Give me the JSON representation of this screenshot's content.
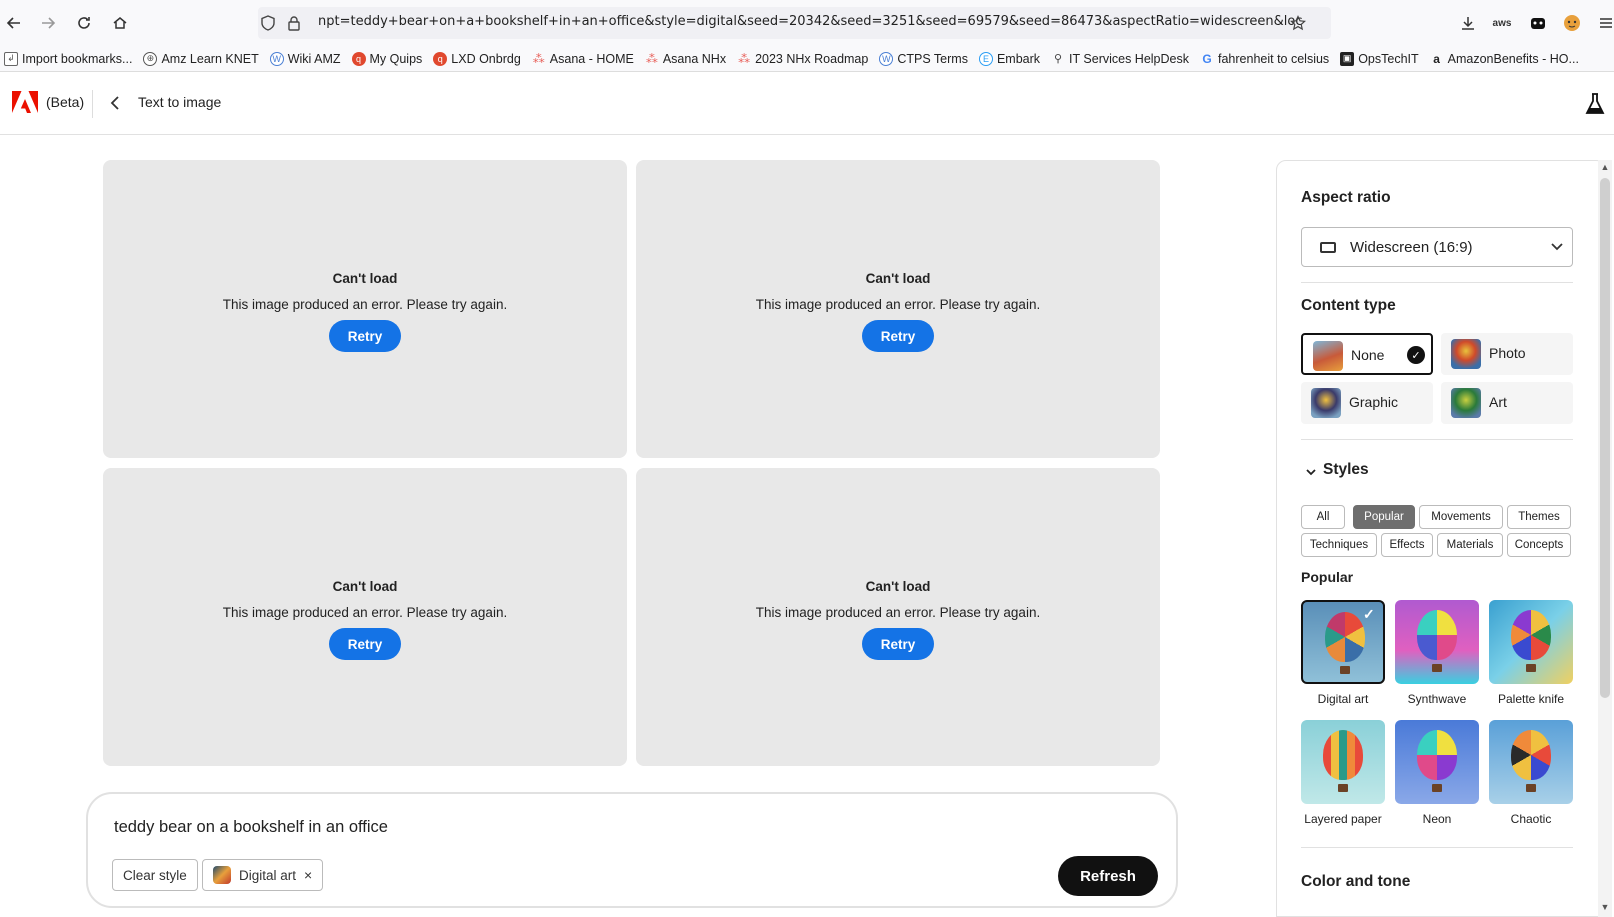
{
  "browser": {
    "url": "npt=teddy+bear+on+a+bookshelf+in+an+office&style=digital&seed=20342&seed=3251&seed=69579&seed=86473&aspectRatio=widescreen&locale=en-us",
    "bookmarks": [
      {
        "label": "Import bookmarks...",
        "icon": "import-icon",
        "color": "#555"
      },
      {
        "label": "Amz Learn KNET",
        "icon": "globe-icon",
        "color": "#555"
      },
      {
        "label": "Wiki AMZ",
        "icon": "wiki-icon",
        "color": "#4a7fd4"
      },
      {
        "label": "My Quips",
        "icon": "quip-icon",
        "color": "#e0482e"
      },
      {
        "label": "LXD Onbrdg",
        "icon": "quip-icon",
        "color": "#e0482e"
      },
      {
        "label": "Asana - HOME",
        "icon": "asana-icon",
        "color": "#e8605a"
      },
      {
        "label": "Asana NHx",
        "icon": "asana-icon",
        "color": "#e8605a"
      },
      {
        "label": "2023 NHx Roadmap",
        "icon": "asana-icon",
        "color": "#e8605a"
      },
      {
        "label": "CTPS Terms",
        "icon": "wiki-icon",
        "color": "#4a7fd4"
      },
      {
        "label": "Embark",
        "icon": "embark-icon",
        "color": "#2a9df4"
      },
      {
        "label": "IT Services HelpDesk",
        "icon": "helpdesk-icon",
        "color": "#444"
      },
      {
        "label": "fahrenheit to celsius",
        "icon": "google-icon",
        "color": "#4285f4"
      },
      {
        "label": "OpsTechIT",
        "icon": "opstech-icon",
        "color": "#222"
      },
      {
        "label": "AmazonBenefits - HO...",
        "icon": "amazon-icon",
        "color": "#222"
      }
    ]
  },
  "app": {
    "beta_label": "(Beta)",
    "page_title": "Text to image"
  },
  "tiles": [
    {
      "title": "Can't load",
      "message": "This image produced an error. Please try again.",
      "retry_label": "Retry"
    },
    {
      "title": "Can't load",
      "message": "This image produced an error. Please try again.",
      "retry_label": "Retry"
    },
    {
      "title": "Can't load",
      "message": "This image produced an error. Please try again.",
      "retry_label": "Retry"
    },
    {
      "title": "Can't load",
      "message": "This image produced an error. Please try again.",
      "retry_label": "Retry"
    }
  ],
  "prompt": {
    "text": "teddy bear on a bookshelf in an office",
    "clear_style_label": "Clear style",
    "style_chip_label": "Digital art",
    "refresh_label": "Refresh"
  },
  "panel": {
    "aspect_ratio_heading": "Aspect ratio",
    "aspect_ratio_value": "Widescreen (16:9)",
    "content_type_heading": "Content type",
    "content_types": [
      {
        "label": "None",
        "selected": true
      },
      {
        "label": "Photo",
        "selected": false
      },
      {
        "label": "Graphic",
        "selected": false
      },
      {
        "label": "Art",
        "selected": false
      }
    ],
    "styles_heading": "Styles",
    "style_tags": [
      {
        "label": "All",
        "active": false
      },
      {
        "label": "Popular",
        "active": true
      },
      {
        "label": "Movements",
        "active": false
      },
      {
        "label": "Themes",
        "active": false
      },
      {
        "label": "Techniques",
        "active": false
      },
      {
        "label": "Effects",
        "active": false
      },
      {
        "label": "Materials",
        "active": false
      },
      {
        "label": "Concepts",
        "active": false
      }
    ],
    "popular_heading": "Popular",
    "popular_styles": [
      {
        "label": "Digital art",
        "selected": true
      },
      {
        "label": "Synthwave",
        "selected": false
      },
      {
        "label": "Palette knife",
        "selected": false
      },
      {
        "label": "Layered paper",
        "selected": false
      },
      {
        "label": "Neon",
        "selected": false
      },
      {
        "label": "Chaotic",
        "selected": false
      }
    ],
    "color_tone_heading": "Color and tone"
  },
  "colors": {
    "accent": "#1473e6",
    "adobe_red": "#eb1000",
    "tile_bg": "#e8e8e8"
  }
}
